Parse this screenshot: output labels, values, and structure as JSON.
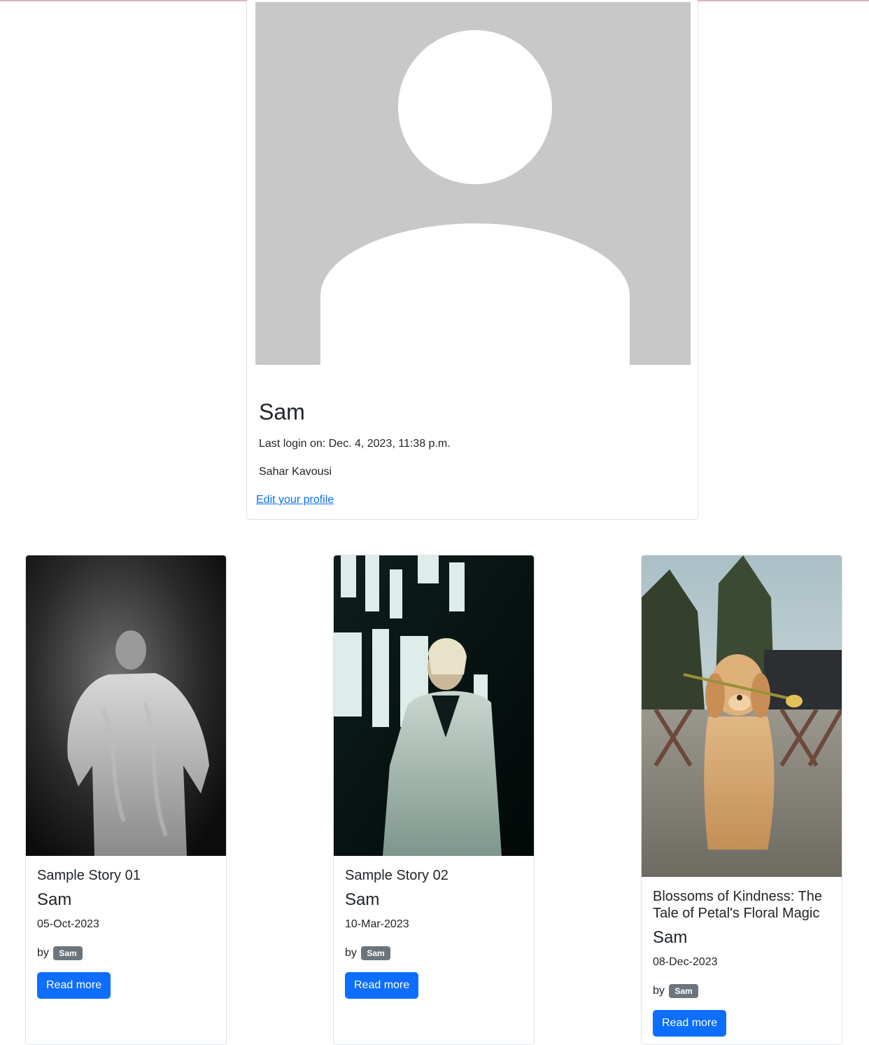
{
  "profile": {
    "username": "Sam",
    "last_login": "Last login on: Dec. 4, 2023, 11:38 p.m.",
    "full_name": "Sahar Kavousi",
    "edit_link": "Edit your profile",
    "avatar_icon": "default-user-avatar"
  },
  "colors": {
    "link": "#0d6efd",
    "button": "#0d6efd",
    "badge": "#6c757d",
    "avatar_bg": "#c8c8c8"
  },
  "stories": [
    {
      "title": "Sample Story 01",
      "author": "Sam",
      "date": "05-Oct-2023",
      "by_label": "by",
      "badge": "Sam",
      "button": "Read more",
      "image": "woman-in-textured-dress-photo"
    },
    {
      "title": "Sample Story 02",
      "author": "Sam",
      "date": "10-Mar-2023",
      "by_label": "by",
      "badge": "Sam",
      "button": "Read more",
      "image": "woman-in-coat-neon-sign-photo"
    },
    {
      "title": "Blossoms of Kindness: The Tale of Petal's Floral Magic",
      "author": "Sam",
      "date": "08-Dec-2023",
      "by_label": "by",
      "badge": "Sam",
      "button": "Read more",
      "image": "puppy-holding-flower-photo"
    }
  ]
}
